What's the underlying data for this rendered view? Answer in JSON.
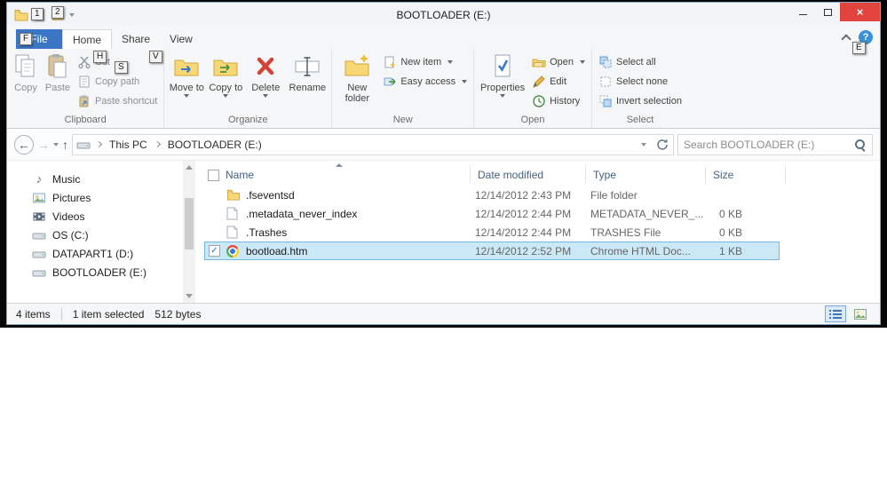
{
  "window": {
    "title": "BOOTLOADER (E:)"
  },
  "icons": {
    "back": "←",
    "forward": "→",
    "up": "↑",
    "help": "?",
    "check": "✓",
    "close": "×",
    "music_note": "♪"
  },
  "keytips": {
    "qat1": "1",
    "qat2": "2",
    "file": "F",
    "home": "H",
    "share": "S",
    "view": "V",
    "help": "E"
  },
  "ribbon": {
    "file_tab": "File",
    "tabs": [
      "Home",
      "Share",
      "View"
    ],
    "clipboard": {
      "label": "Clipboard",
      "copy": "Copy",
      "paste": "Paste",
      "cut": "Cut",
      "copy_path": "Copy path",
      "paste_shortcut": "Paste shortcut"
    },
    "organize": {
      "label": "Organize",
      "move_to": "Move to",
      "copy_to": "Copy to",
      "delete": "Delete",
      "rename": "Rename"
    },
    "new": {
      "label": "New",
      "new_folder": "New folder",
      "new_item": "New item",
      "easy_access": "Easy access"
    },
    "open": {
      "label": "Open",
      "properties": "Properties",
      "open": "Open",
      "edit": "Edit",
      "history": "History"
    },
    "select": {
      "label": "Select",
      "select_all": "Select all",
      "select_none": "Select none",
      "invert": "Invert selection"
    }
  },
  "addressbar": {
    "breadcrumb": [
      "This PC",
      "BOOTLOADER (E:)"
    ],
    "search_placeholder": "Search BOOTLOADER (E:)"
  },
  "sidebar": {
    "items": [
      {
        "label": "Music"
      },
      {
        "label": "Pictures"
      },
      {
        "label": "Videos"
      },
      {
        "label": "OS (C:)"
      },
      {
        "label": "DATAPART1 (D:)"
      },
      {
        "label": "BOOTLOADER (E:)"
      }
    ]
  },
  "filelist": {
    "columns": [
      "Name",
      "Date modified",
      "Type",
      "Size"
    ],
    "rows": [
      {
        "name": ".fseventsd",
        "date": "12/14/2012 2:43 PM",
        "type": "File folder",
        "size": ""
      },
      {
        "name": ".metadata_never_index",
        "date": "12/14/2012 2:44 PM",
        "type": "METADATA_NEVER_...",
        "size": "0 KB"
      },
      {
        "name": ".Trashes",
        "date": "12/14/2012 2:44 PM",
        "type": "TRASHES File",
        "size": "0 KB"
      },
      {
        "name": "bootload.htm",
        "date": "12/14/2012 2:52 PM",
        "type": "Chrome HTML Doc...",
        "size": "1 KB"
      }
    ]
  },
  "statusbar": {
    "items_count": "4 items",
    "selected": "1 item selected",
    "size": "512 bytes"
  }
}
